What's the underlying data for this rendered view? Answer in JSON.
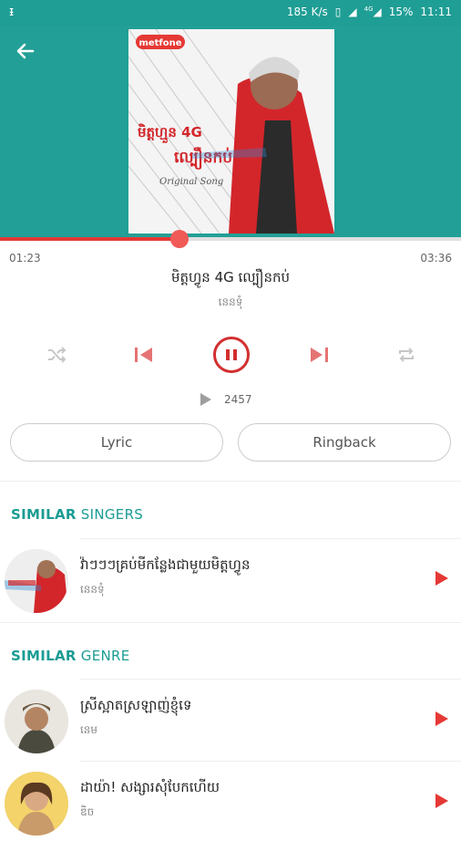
{
  "status_bar": {
    "net_speed": "185 K/s",
    "network_badge": "4G",
    "battery": "15%",
    "time": "11:11",
    "icons": [
      "notification-icon",
      "vibrate-icon",
      "signal-icon",
      "signal-4g-icon"
    ]
  },
  "header": {
    "back_icon": "arrow-left-icon",
    "bg_color": "#229f96",
    "cover": {
      "brand": "metfone",
      "title_line1": "មិត្តហ្មួន 4G",
      "title_line2": "ល្បឿនកប់",
      "subtitle": "Original Song"
    }
  },
  "player": {
    "progress": 0.39,
    "elapsed": "01:23",
    "duration": "03:36",
    "song_title": "មិត្តហ្វូន 4G ល្បឿនកប់",
    "artist": "នេនទុំ",
    "play_count": "2457",
    "accent_color": "#d32f2f"
  },
  "buttons": {
    "lyric": "Lyric",
    "ringback": "Ringback"
  },
  "similar_singers": {
    "title_bold": "SIMILAR",
    "title_light": "SINGERS",
    "items": [
      {
        "title": "វ៉ាៗៗៗគ្រប់មីកន្លែងជាមួយមិត្តហ្វូន",
        "artist": "នេនទុំ"
      }
    ]
  },
  "similar_genre": {
    "title_bold": "SIMILAR",
    "title_light": "GENRE",
    "items": [
      {
        "title": "ស្រីស្អាតស្រឡាញ់ខ្ញុំទេ",
        "artist": "នេម"
      },
      {
        "title": "ដាយ៉ា! សង្សារសុំបែកហើយ",
        "artist": "ឌិច"
      }
    ]
  }
}
